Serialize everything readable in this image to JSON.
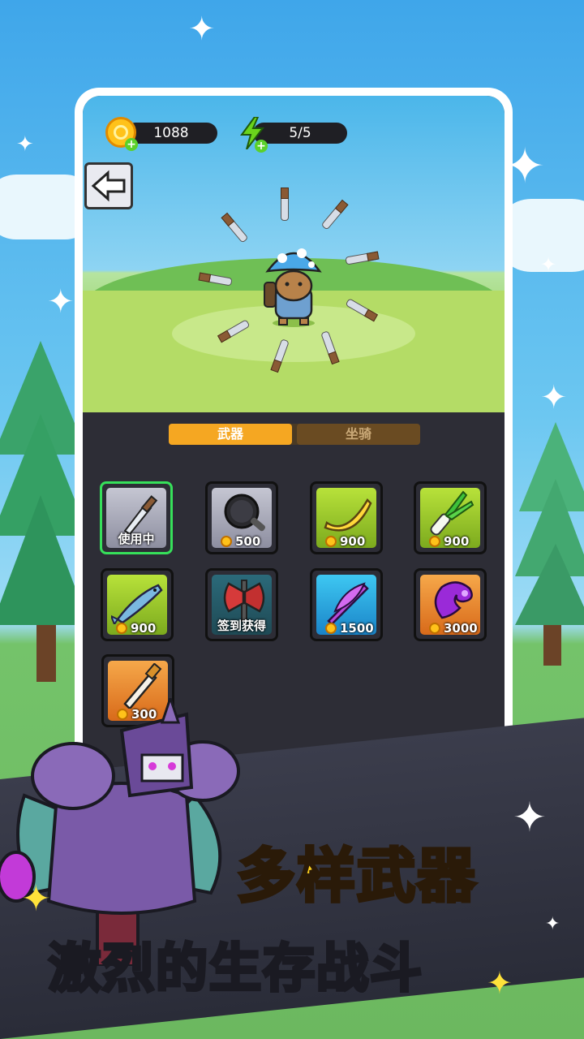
{
  "hud": {
    "coins": "1088",
    "energy": "5/5"
  },
  "tabs": [
    {
      "label": "武器",
      "active": true
    },
    {
      "label": "坐骑",
      "active": false
    }
  ],
  "items": [
    {
      "name": "dagger",
      "label": "使用中",
      "price": null,
      "bg": "grey",
      "selected": true
    },
    {
      "name": "frying-pan",
      "label": null,
      "price": "500",
      "bg": "grey",
      "selected": false
    },
    {
      "name": "banana",
      "label": null,
      "price": "900",
      "bg": "green",
      "selected": false
    },
    {
      "name": "leek",
      "label": null,
      "price": "900",
      "bg": "green",
      "selected": false
    },
    {
      "name": "fish",
      "label": null,
      "price": "900",
      "bg": "green",
      "selected": false
    },
    {
      "name": "battle-axe",
      "label": "签到获得",
      "price": null,
      "bg": "teal",
      "selected": false
    },
    {
      "name": "umbrella",
      "label": null,
      "price": "1500",
      "bg": "blue",
      "selected": false
    },
    {
      "name": "purple-slime",
      "label": null,
      "price": "3000",
      "bg": "orange",
      "selected": false
    },
    {
      "name": "flame-sword",
      "label": null,
      "price": "300",
      "bg": "orange",
      "selected": false
    }
  ],
  "promo": {
    "headline": "多样武器",
    "subline": "激烈的生存战斗"
  },
  "colors": {
    "tab_active": "#f5a722",
    "selected_border": "#36e05a",
    "headline": "#ffd21e"
  }
}
